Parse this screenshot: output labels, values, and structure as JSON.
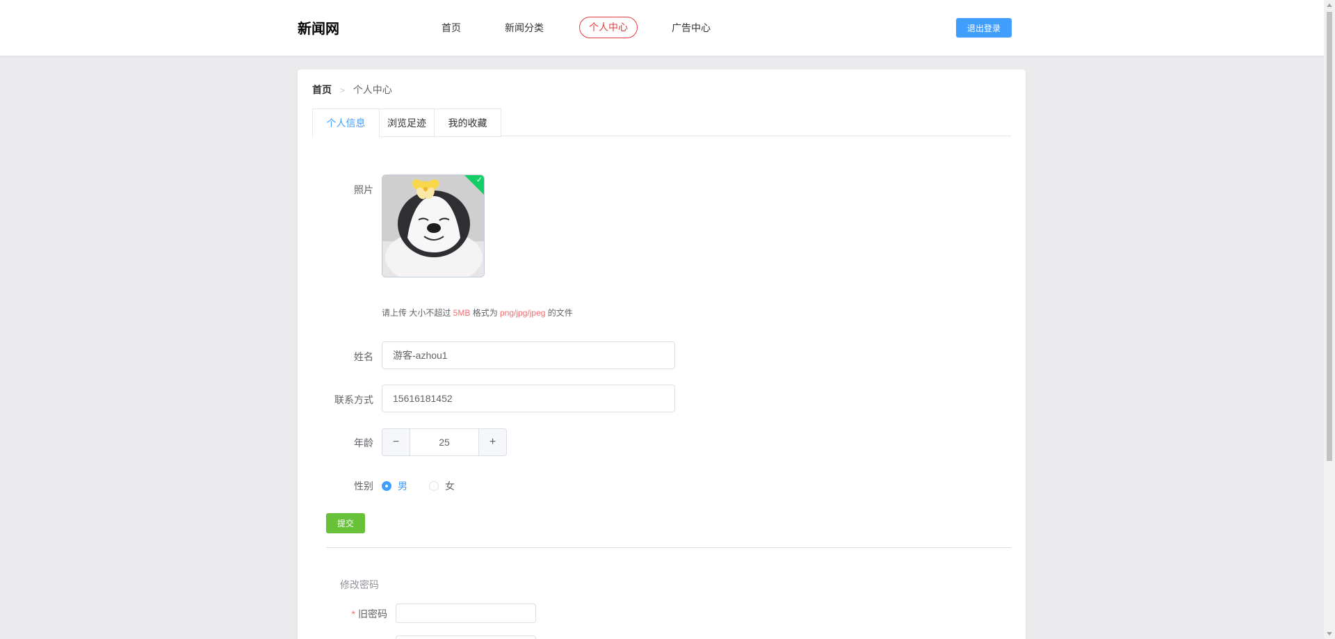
{
  "header": {
    "logo": "新闻网",
    "nav": [
      {
        "label": "首页"
      },
      {
        "label": "新闻分类"
      },
      {
        "label": "个人中心",
        "active": true
      },
      {
        "label": "广告中心"
      }
    ],
    "logout_label": "退出登录"
  },
  "breadcrumb": {
    "home": "首页",
    "separator": ">",
    "current": "个人中心"
  },
  "tabs": [
    {
      "label": "个人信息",
      "active": true
    },
    {
      "label": "浏览足迹"
    },
    {
      "label": "我的收藏"
    }
  ],
  "profile": {
    "photo_label": "照片",
    "upload_tip": {
      "prefix": "请上传 大小不超过 ",
      "size": "5MB",
      "middle": " 格式为 ",
      "formats": "png/jpg/jpeg",
      "suffix": " 的文件"
    },
    "name_label": "姓名",
    "name_value": "游客-azhou1",
    "contact_label": "联系方式",
    "contact_value": "15616181452",
    "age_label": "年龄",
    "age_value": "25",
    "minus_symbol": "−",
    "plus_symbol": "+",
    "gender_label": "性别",
    "gender_options": [
      {
        "label": "男",
        "checked": true
      },
      {
        "label": "女",
        "checked": false
      }
    ],
    "submit_label": "提交"
  },
  "password": {
    "section_title": "修改密码",
    "required_mark": "*",
    "old_password_label": "旧密码"
  },
  "colors": {
    "accent": "#409eff",
    "nav_active": "#e4393c",
    "submit": "#67c23a",
    "highlight": "#f56c6c"
  }
}
